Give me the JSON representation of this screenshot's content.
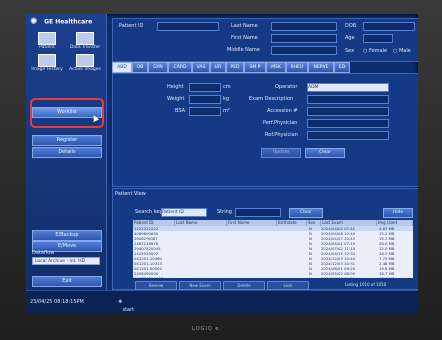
{
  "brand": {
    "logo": "GE Healthcare",
    "device": "LOGIQ e"
  },
  "sidebar": {
    "icons": [
      {
        "label": "Patient",
        "icon": "patient-icon"
      },
      {
        "label": "Data Transfer",
        "icon": "data-transfer-icon"
      },
      {
        "label": "Image History",
        "icon": "image-history-icon"
      },
      {
        "label": "Active Images",
        "icon": "active-images-icon"
      }
    ],
    "buttons": [
      {
        "label": "Worklist"
      },
      {
        "label": "Register"
      },
      {
        "label": "Details"
      }
    ],
    "lower_buttons": [
      {
        "label": "E/Backup"
      },
      {
        "label": "E/Move"
      }
    ],
    "destination_label": "Dataflow",
    "destination_value": "Local Archive - Int. HD",
    "exit_label": "Exit"
  },
  "patient_header": {
    "patient_id_label": "Patient ID",
    "last_name_label": "Last Name",
    "first_name_label": "First Name",
    "middle_name_label": "Middle Name",
    "dob_label": "DOB",
    "age_label": "Age",
    "sex_label": "Sex",
    "sex_options": [
      "Female",
      "Male"
    ]
  },
  "tabs": [
    "ABD",
    "OB",
    "GYN",
    "CARD",
    "VAS",
    "UR",
    "PED",
    "SM P",
    "MSK",
    "RHEU",
    "NERVE",
    "ED"
  ],
  "form": {
    "height_label": "Height",
    "height_unit": "cm",
    "weight_label": "Weight",
    "weight_unit": "kg",
    "bsa_label": "BSA",
    "bsa_unit": "m²",
    "operator_label": "Operator",
    "operator_value": "ADM",
    "exam_desc_label": "Exam Description",
    "accession_label": "Accession #",
    "perf_physician_label": "Perf.Physician",
    "ref_physician_label": "Ref.Physician",
    "update_button": "Update",
    "clear_button": "Clear"
  },
  "patient_view": {
    "title": "Patient View",
    "search_key_label": "Search key",
    "search_key_value": "Patient ID",
    "string_label": "String",
    "clear_button": "Clear",
    "hide_button": "Hide",
    "columns": [
      "Patient ID",
      "Last Name",
      "First Name",
      "Birthdate",
      "Sex",
      "Last Exam",
      "Img Used"
    ],
    "rows": [
      [
        "2222222222",
        "",
        "",
        "",
        "N",
        "2024/04/02 07:41",
        "4.87 MB"
      ],
      [
        "4089800650",
        "",
        "",
        "",
        "N",
        "2024/04/08 10:40",
        "15.2 MB"
      ],
      [
        "26082*0087",
        "",
        "",
        "",
        "N",
        "2024/04/07 10:43",
        "15.1 MB"
      ],
      [
        "2462118978",
        "",
        "",
        "",
        "N",
        "2024/04/01 07:10",
        "28.0 MB"
      ],
      [
        "29407520045",
        "",
        "",
        "",
        "N",
        "2024/07/02 11:10",
        "12.0 MB"
      ],
      [
        "2425520002",
        "",
        "",
        "",
        "N",
        "2024/04/15 12:34",
        "28.3 MB"
      ],
      [
        "041201-10480",
        "",
        "",
        "",
        "N",
        "2024/12/03 10:40",
        "7.72 MB"
      ],
      [
        "041201-10313",
        "",
        "",
        "",
        "N",
        "2024/12/03 10:31",
        "2.48 MB"
      ],
      [
        "041201-00002",
        "",
        "",
        "",
        "N",
        "2024/06/01 09:20",
        "19.8 MB"
      ],
      [
        "2408490000",
        "",
        "",
        "",
        "N",
        "2024/05/02 08:09",
        "18.7 MB"
      ],
      [
        "240820800005",
        "",
        "",
        "",
        "N",
        "2024/04/19 04:50",
        "12.9 MB"
      ]
    ],
    "bottom_buttons": [
      "Review",
      "New Exam",
      "Delete",
      "Lock"
    ],
    "listing_text": "Listing 1010 of 1010"
  },
  "status": {
    "datetime": "23/04/25 08:18:15PM",
    "start": "start"
  },
  "colors": {
    "highlight": "#e43b3b",
    "screen": "#0d2c6e"
  }
}
